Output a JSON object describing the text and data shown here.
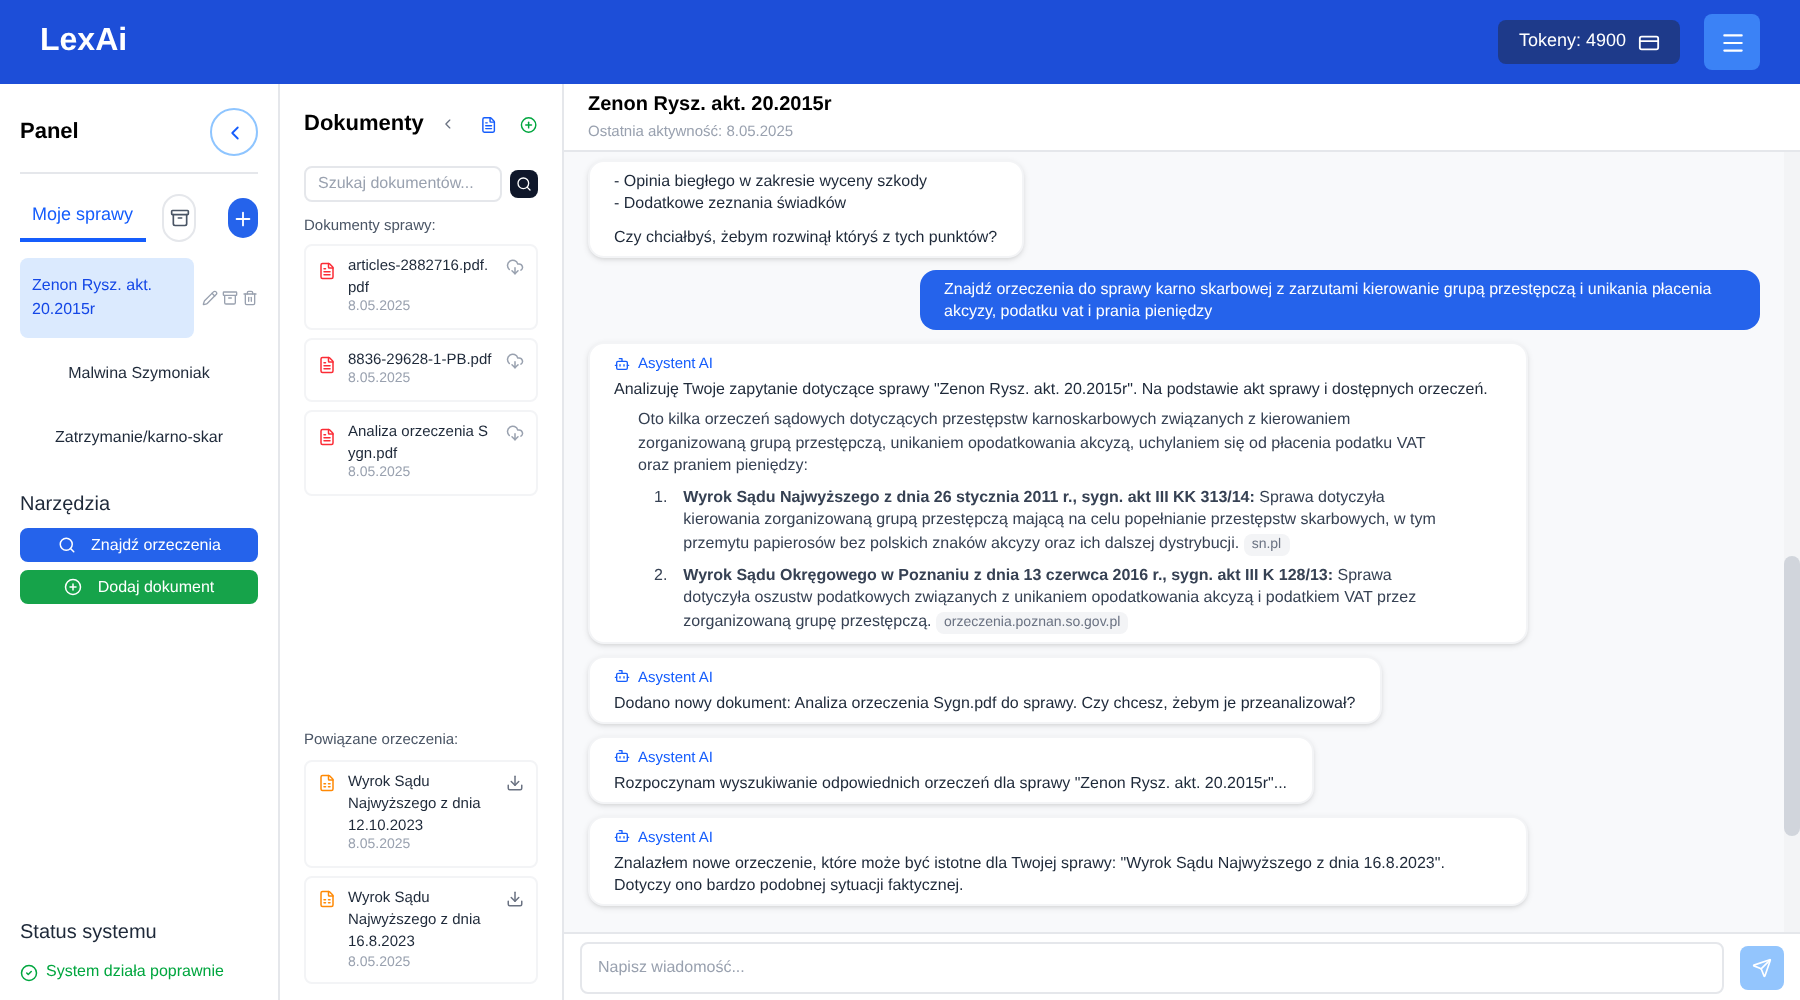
{
  "app": {
    "title": "LexAi",
    "tokens": "Tokeny: 4900"
  },
  "panel": {
    "title": "Panel",
    "tabs": [
      {
        "kind": "text",
        "label": "Moje sprawy",
        "selected": true
      },
      {
        "kind": "icon",
        "selected": false
      }
    ],
    "cases": [
      {
        "name": "Zenon Rysz. akt. 20.2015r",
        "selected": true
      },
      {
        "name": "Malwina Szymoniak",
        "selected": false
      },
      {
        "name": "Zatrzymanie/karno-skar",
        "selected": false
      }
    ],
    "tools_title": "Narzędzia",
    "tools": [
      {
        "kind": "search",
        "label": "Znajdź orzeczenia"
      },
      {
        "kind": "add",
        "label": "Dodaj dokument"
      }
    ],
    "status_title": "Status systemu",
    "status": "System działa poprawnie"
  },
  "documents": {
    "title": "Dokumenty",
    "search_placeholder": "Szukaj dokumentów...",
    "list_title": "Dokumenty sprawy:",
    "files": [
      {
        "name": "articles-2882716.pdf.pdf",
        "date": "8.05.2025"
      },
      {
        "name": "8836-29628-1-PB.pdf",
        "date": "8.05.2025"
      },
      {
        "name": "Analiza orzeczenia Sygn.pdf",
        "date": "8.05.2025"
      }
    ],
    "related_title": "Powiązane orzeczenia:",
    "related": [
      {
        "title": "Wyrok Sądu Najwyższego z dnia 12.10.2023",
        "date": "8.05.2025"
      },
      {
        "title": "Wyrok Sądu Najwyższego z dnia 16.8.2023",
        "date": "8.05.2025"
      }
    ]
  },
  "chat": {
    "title": "Zenon Rysz. akt. 20.2015r",
    "subtitle": "Ostatnia aktywność: 8.05.2025",
    "messages": [
      {
        "kind": "assistant",
        "blocks": [
          {
            "kind": "text",
            "text": "- Opinia biegłego w zakresie wyceny szkody"
          },
          {
            "kind": "text",
            "text": "- Dodatkowe zeznania świadków"
          },
          {
            "kind": "gap"
          },
          {
            "kind": "text",
            "text": "Czy chciałbyś, żebym rozwinął któryś z tych punktów?"
          }
        ]
      },
      {
        "kind": "user",
        "blocks": [
          {
            "kind": "text",
            "text": "Znajdź orzeczenia do sprawy karno skarbowej z zarzutami kierowanie grupą przestępczą i unikania płacenia akcyzy, podatku vat i prania pieniędzy"
          }
        ]
      },
      {
        "kind": "assistant",
        "sender": "Asystent AI",
        "blocks": [
          {
            "kind": "text",
            "text": "Analizuję Twoje zapytanie dotyczące sprawy \"Zenon Rysz. akt. 20.2015r\". Na podstawie akt sprawy i dostępnych orzeczeń."
          },
          {
            "kind": "indent",
            "text": "Oto kilka orzeczeń sądowych dotyczących przestępstw karnoskarbowych związanych z kierowaniem zorganizowaną grupą przestępczą, unikaniem opodatkowania akcyzą, uchylaniem się od płacenia podatku VAT oraz praniem pieniędzy:"
          },
          {
            "kind": "list",
            "items": [
              {
                "number": "1.",
                "text": "**Wyrok Sądu Najwyższego z dnia 26 stycznia 2011 r., sygn. akt III KK 313/14:** Sprawa dotyczyła kierowania zorganizowaną grupą przestępczą mającą na celu popełnianie przestępstw skarbowych, w tym przemytu papierosów bez polskich znaków akcyzy oraz ich dalszej dystrybucji.",
                "source": "sn.pl"
              },
              {
                "number": "2.",
                "text": "**Wyrok Sądu Okręgowego w Poznaniu z dnia 13 czerwca 2016 r., sygn. akt III K 128/13:** Sprawa dotyczyła oszustw podatkowych związanych z unikaniem opodatkowania akcyzą i podatkiem VAT przez zorganizowaną grupę przestępczą.",
                "source": "orzeczenia.poznan.so.gov.pl"
              }
            ]
          }
        ]
      },
      {
        "kind": "assistant",
        "sender": "Asystent AI",
        "blocks": [
          {
            "kind": "text",
            "text": "Dodano nowy dokument: Analiza orzeczenia Sygn.pdf do sprawy. Czy chcesz, żebym je przeanalizował?"
          }
        ]
      },
      {
        "kind": "assistant",
        "sender": "Asystent AI",
        "blocks": [
          {
            "kind": "text",
            "text": "Rozpoczynam wyszukiwanie odpowiednich orzeczeń dla sprawy \"Zenon Rysz. akt. 20.2015r\"..."
          }
        ]
      },
      {
        "kind": "assistant",
        "sender": "Asystent AI",
        "blocks": [
          {
            "kind": "text",
            "text": "Znalazłem nowe orzeczenie, które może być istotne dla Twojej sprawy: \"Wyrok Sądu Najwyższego z dnia 16.8.2023\". Dotyczy ono bardzo podobnej sytuacji faktycznej."
          }
        ]
      }
    ],
    "input_placeholder": "Napisz wiadomość...",
    "send_disabled": true
  }
}
